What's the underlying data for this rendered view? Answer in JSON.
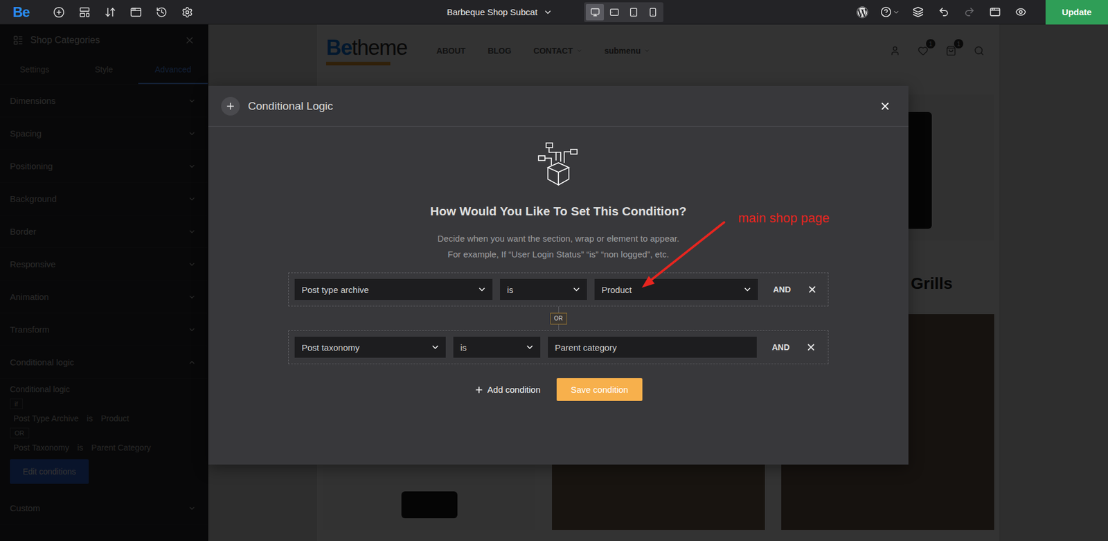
{
  "toolbar": {
    "logo": "Be",
    "page_title": "Barbeque Shop Subcat",
    "devices": [
      {
        "selected": true
      },
      {
        "selected": false
      },
      {
        "selected": false
      },
      {
        "selected": false
      }
    ],
    "undo_disabled": false,
    "redo_disabled": true,
    "update_button": "Update"
  },
  "sidebar": {
    "title": "Shop Categories",
    "tabs": [
      {
        "label": "Settings",
        "selected": false
      },
      {
        "label": "Style",
        "selected": false
      },
      {
        "label": "Advanced",
        "selected": true
      }
    ],
    "sections": [
      {
        "label": "Dimensions",
        "expanded": false
      },
      {
        "label": "Spacing",
        "expanded": false
      },
      {
        "label": "Positioning",
        "expanded": false
      },
      {
        "label": "Background",
        "expanded": false
      },
      {
        "label": "Border",
        "expanded": false
      },
      {
        "label": "Responsive",
        "expanded": false
      },
      {
        "label": "Animation",
        "expanded": false
      },
      {
        "label": "Transform",
        "expanded": false
      },
      {
        "label": "Conditional logic",
        "expanded": true
      }
    ],
    "conditional_logic": {
      "label": "Conditional logic",
      "if_badge": "if",
      "groups": [
        {
          "rule": [
            "Post Type Archive",
            "is",
            "Product"
          ]
        },
        {
          "rule": [
            "Post Taxonomy",
            "is",
            "Parent Category"
          ]
        }
      ],
      "or_badge": "OR",
      "edit_button": "Edit conditions"
    },
    "next_section": {
      "label": "Custom",
      "expanded": false
    }
  },
  "page": {
    "logo": {
      "accent": "Be",
      "rest": "theme"
    },
    "nav": [
      {
        "label": "ABOUT",
        "has_submenu": false
      },
      {
        "label": "BLOG",
        "has_submenu": false
      },
      {
        "label": "CONTACT",
        "has_submenu": true
      },
      {
        "label": "submenu",
        "has_submenu": true
      }
    ],
    "badges": [
      "1",
      "1"
    ],
    "heading": "Grills"
  },
  "modal": {
    "title": "Conditional Logic",
    "heading": "How Would You Like To Set This Condition?",
    "description": [
      "Decide when you want the section, wrap or element to appear.",
      "For example, If “User Login Status” “is” “non logged”, etc."
    ],
    "rules": [
      {
        "fields": [
          {
            "kind": "select",
            "value": "Post type archive"
          },
          {
            "kind": "select",
            "value": "is"
          },
          {
            "kind": "select",
            "value": "Product"
          }
        ],
        "connector": "AND"
      },
      {
        "fields": [
          {
            "kind": "select",
            "value": "Post taxonomy"
          },
          {
            "kind": "select",
            "value": "is"
          },
          {
            "kind": "input",
            "value": "Parent category"
          }
        ],
        "connector": "AND"
      }
    ],
    "or_badge": "OR",
    "add_button": "Add condition",
    "save_button": "Save condition"
  },
  "annotation": {
    "text": "main shop page"
  }
}
